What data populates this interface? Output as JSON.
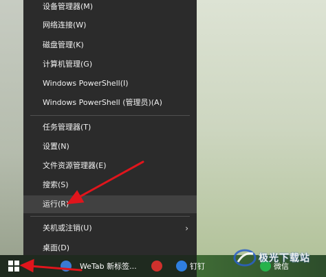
{
  "menu": {
    "items": [
      {
        "label": "设备管理器(M)"
      },
      {
        "label": "网络连接(W)"
      },
      {
        "label": "磁盘管理(K)"
      },
      {
        "label": "计算机管理(G)"
      },
      {
        "label": "Windows PowerShell(I)"
      },
      {
        "label": "Windows PowerShell (管理员)(A)"
      },
      {
        "label": "任务管理器(T)"
      },
      {
        "label": "设置(N)"
      },
      {
        "label": "文件资源管理器(E)"
      },
      {
        "label": "搜索(S)"
      },
      {
        "label": "运行(R)"
      },
      {
        "label": "关机或注销(U)"
      },
      {
        "label": "桌面(D)"
      }
    ]
  },
  "taskbar": {
    "item1": "WeTab 新标签...",
    "item2": "钉钉",
    "item3": "微信"
  },
  "watermark": {
    "text": "极光下载站"
  },
  "colors": {
    "arrow": "#e0151c",
    "menu_bg": "#2b2b2b",
    "highlight": "#414141"
  }
}
